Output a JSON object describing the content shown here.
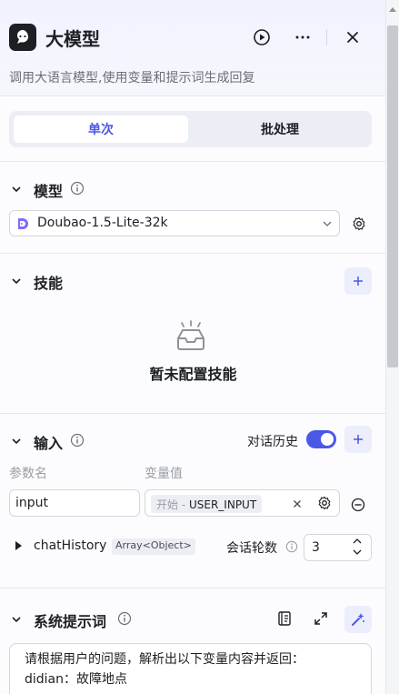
{
  "header": {
    "title": "大模型",
    "subtitle": "调用大语言模型,使用变量和提示词生成回复"
  },
  "tabs": [
    {
      "label": "单次",
      "active": true
    },
    {
      "label": "批处理",
      "active": false
    }
  ],
  "model_section": {
    "title": "模型",
    "selected_model": "Doubao-1.5-Lite-32k"
  },
  "skills_section": {
    "title": "技能",
    "empty_text": "暂未配置技能"
  },
  "input_section": {
    "title": "输入",
    "history_label": "对话历史",
    "history_enabled": true,
    "param_header": "参数名",
    "value_header": "变量值",
    "param_name": "input",
    "var_source": "开始 -",
    "var_name": "USER_INPUT",
    "history_param": "chatHistory",
    "history_type": "Array<Object>",
    "rounds_label": "会话轮数",
    "rounds_value": "3"
  },
  "system_prompt": {
    "title": "系统提示词",
    "line1": "请根据用户的问题，解析出以下变量内容并返回：",
    "line2": "didian：故障地点",
    "line3": "…"
  },
  "colors": {
    "accent": "#4a58e6",
    "accent_light": "#eceefc"
  }
}
